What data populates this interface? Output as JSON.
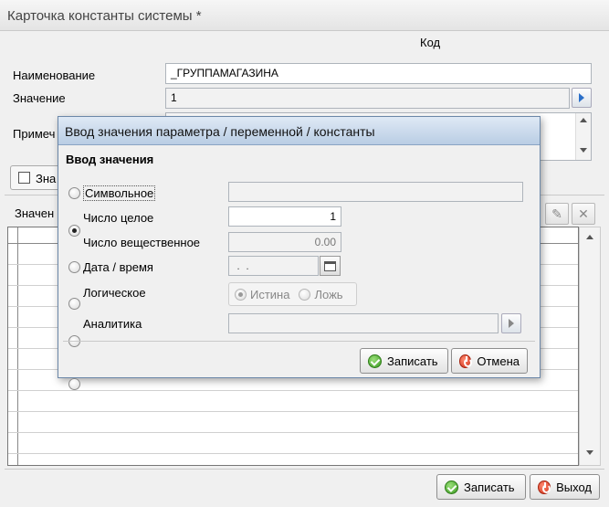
{
  "window": {
    "title": "Карточка константы системы *",
    "code_label": "Код"
  },
  "form": {
    "name_label": "Наименование",
    "name_value": "_ГРУППАМАГАЗИНА",
    "value_label": "Значение",
    "value_value": "1",
    "note_label": "Примеч",
    "checkbox_label": "Зна",
    "grid_label": "Значен"
  },
  "dialog": {
    "title": "Ввод значения параметра / переменной / константы",
    "section_title": "Ввод значения",
    "options": [
      {
        "label": "Символьное",
        "selected": false,
        "value": ""
      },
      {
        "label": "Число целое",
        "selected": true,
        "value": "1"
      },
      {
        "label": "Число вещественное",
        "selected": false,
        "value": "0.00"
      },
      {
        "label": "Дата / время",
        "selected": false,
        "value": " .  ."
      },
      {
        "label": "Логическое",
        "selected": false
      },
      {
        "label": "Аналитика",
        "selected": false,
        "value": ""
      }
    ],
    "bool_true": "Истина",
    "bool_false": "Ложь",
    "save_label": "Записать",
    "cancel_label": "Отмена"
  },
  "footer": {
    "save_label": "Записать",
    "exit_label": "Выход"
  }
}
